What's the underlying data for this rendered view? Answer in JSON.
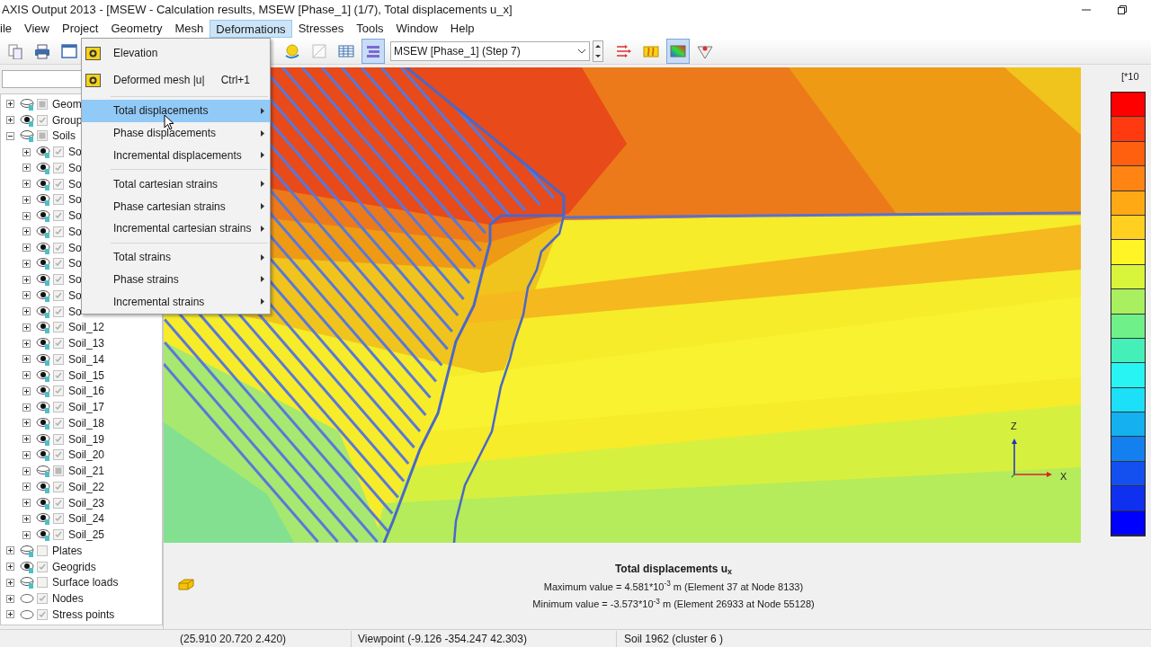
{
  "window": {
    "title": "AXIS Output 2013 - [MSEW - Calculation results, MSEW [Phase_1] (1/7), Total displacements u_x]"
  },
  "menu_bar": [
    {
      "label": "ile",
      "selected": false
    },
    {
      "label": "View",
      "selected": false
    },
    {
      "label": "Project",
      "selected": false
    },
    {
      "label": "Geometry",
      "selected": false
    },
    {
      "label": "Mesh",
      "selected": false
    },
    {
      "label": "Deformations",
      "selected": true
    },
    {
      "label": "Stresses",
      "selected": false
    },
    {
      "label": "Tools",
      "selected": false
    },
    {
      "label": "Window",
      "selected": false
    },
    {
      "label": "Help",
      "selected": false
    }
  ],
  "toolbar": {
    "left_buttons": [
      {
        "kind": "copy",
        "selected": false
      },
      {
        "kind": "print",
        "selected": false
      },
      {
        "kind": "window",
        "selected": false
      }
    ],
    "middle_buttons": [
      {
        "kind": "bulb",
        "selected": false
      },
      {
        "kind": "disabled",
        "selected": false
      },
      {
        "kind": "table",
        "selected": false
      },
      {
        "kind": "list",
        "selected": true
      }
    ],
    "step_selector": {
      "value": "MSEW [Phase_1] (Step 7)"
    },
    "right_buttons": [
      {
        "kind": "arrows",
        "selected": false
      },
      {
        "kind": "wave",
        "selected": false
      },
      {
        "kind": "gradient",
        "selected": true
      },
      {
        "kind": "funnel",
        "selected": false
      }
    ]
  },
  "deformations_menu": [
    {
      "label": "Elevation",
      "icon": true,
      "submenu": false,
      "selected": false,
      "separator_before": false
    },
    {
      "label": "Deformed mesh |u|",
      "shortcut": "Ctrl+1",
      "icon": true,
      "submenu": false,
      "selected": false,
      "separator_before": false
    },
    {
      "label": "Total displacements",
      "icon": false,
      "submenu": true,
      "selected": true,
      "separator_before": true
    },
    {
      "label": "Phase displacements",
      "icon": false,
      "submenu": true,
      "selected": false,
      "separator_before": false
    },
    {
      "label": "Incremental displacements",
      "icon": false,
      "submenu": true,
      "selected": false,
      "separator_before": false
    },
    {
      "label": "Total cartesian strains",
      "icon": false,
      "submenu": true,
      "selected": false,
      "separator_before": true
    },
    {
      "label": "Phase cartesian strains",
      "icon": false,
      "submenu": true,
      "selected": false,
      "separator_before": false
    },
    {
      "label": "Incremental cartesian strains",
      "icon": false,
      "submenu": true,
      "selected": false,
      "separator_before": false
    },
    {
      "label": "Total strains",
      "icon": false,
      "submenu": true,
      "selected": false,
      "separator_before": true
    },
    {
      "label": "Phase strains",
      "icon": false,
      "submenu": true,
      "selected": false,
      "separator_before": false
    },
    {
      "label": "Incremental strains",
      "icon": false,
      "submenu": true,
      "selected": false,
      "separator_before": false
    }
  ],
  "model_tree": [
    {
      "label": "Geom",
      "kind": "eye",
      "visible": false,
      "checked": false,
      "greyed": true,
      "expanded": false
    },
    {
      "label": "Group",
      "kind": "eye",
      "visible": true,
      "checked": true,
      "greyed": false,
      "expanded": false
    },
    {
      "label": "Soils",
      "kind": "eye",
      "visible": false,
      "checked": false,
      "greyed": true,
      "expanded": true,
      "children": [
        {
          "label": "So",
          "kind": "eye",
          "visible": true,
          "checked": true,
          "greyed": false,
          "expanded": false
        },
        {
          "label": "So",
          "kind": "eye",
          "visible": true,
          "checked": true,
          "greyed": false,
          "expanded": false
        },
        {
          "label": "So",
          "kind": "eye",
          "visible": true,
          "checked": true,
          "greyed": false,
          "expanded": false
        },
        {
          "label": "So",
          "kind": "eye",
          "visible": true,
          "checked": true,
          "greyed": false,
          "expanded": false
        },
        {
          "label": "So",
          "kind": "eye",
          "visible": true,
          "checked": true,
          "greyed": false,
          "expanded": false
        },
        {
          "label": "So",
          "kind": "eye",
          "visible": true,
          "checked": true,
          "greyed": false,
          "expanded": false
        },
        {
          "label": "So",
          "kind": "eye",
          "visible": true,
          "checked": true,
          "greyed": false,
          "expanded": false
        },
        {
          "label": "So",
          "kind": "eye",
          "visible": true,
          "checked": true,
          "greyed": false,
          "expanded": false
        },
        {
          "label": "So",
          "kind": "eye",
          "visible": true,
          "checked": true,
          "greyed": false,
          "expanded": false
        },
        {
          "label": "So",
          "kind": "eye",
          "visible": true,
          "checked": true,
          "greyed": false,
          "expanded": false
        },
        {
          "label": "So",
          "kind": "eye",
          "visible": true,
          "checked": true,
          "greyed": false,
          "expanded": false
        },
        {
          "label": "Soil_12",
          "kind": "eye",
          "visible": true,
          "checked": true,
          "greyed": false,
          "expanded": false
        },
        {
          "label": "Soil_13",
          "kind": "eye",
          "visible": true,
          "checked": true,
          "greyed": false,
          "expanded": false
        },
        {
          "label": "Soil_14",
          "kind": "eye",
          "visible": true,
          "checked": true,
          "greyed": false,
          "expanded": false
        },
        {
          "label": "Soil_15",
          "kind": "eye",
          "visible": true,
          "checked": true,
          "greyed": false,
          "expanded": false
        },
        {
          "label": "Soil_16",
          "kind": "eye",
          "visible": true,
          "checked": true,
          "greyed": false,
          "expanded": false
        },
        {
          "label": "Soil_17",
          "kind": "eye",
          "visible": true,
          "checked": true,
          "greyed": false,
          "expanded": false
        },
        {
          "label": "Soil_18",
          "kind": "eye",
          "visible": true,
          "checked": true,
          "greyed": false,
          "expanded": false
        },
        {
          "label": "Soil_19",
          "kind": "eye",
          "visible": true,
          "checked": true,
          "greyed": false,
          "expanded": false
        },
        {
          "label": "Soil_20",
          "kind": "eye",
          "visible": true,
          "checked": true,
          "greyed": false,
          "expanded": false
        },
        {
          "label": "Soil_21",
          "kind": "eye",
          "visible": false,
          "checked": false,
          "greyed": true,
          "expanded": false
        },
        {
          "label": "Soil_22",
          "kind": "eye",
          "visible": true,
          "checked": true,
          "greyed": false,
          "expanded": false
        },
        {
          "label": "Soil_23",
          "kind": "eye",
          "visible": true,
          "checked": true,
          "greyed": false,
          "expanded": false
        },
        {
          "label": "Soil_24",
          "kind": "eye",
          "visible": true,
          "checked": true,
          "greyed": false,
          "expanded": false
        },
        {
          "label": "Soil_25",
          "kind": "eye",
          "visible": true,
          "checked": true,
          "greyed": false,
          "expanded": false
        }
      ]
    },
    {
      "label": "Plates",
      "kind": "eye",
      "visible": false,
      "checked": false,
      "greyed": false,
      "expanded": false
    },
    {
      "label": "Geogrids",
      "kind": "eye",
      "visible": true,
      "checked": true,
      "greyed": false,
      "expanded": false
    },
    {
      "label": "Surface loads",
      "kind": "eye",
      "visible": false,
      "checked": false,
      "greyed": false,
      "expanded": false
    },
    {
      "label": "Nodes",
      "kind": "oval",
      "checked": true,
      "greyed": false,
      "expanded": false
    },
    {
      "label": "Stress points",
      "kind": "oval",
      "checked": true,
      "greyed": false,
      "expanded": false
    }
  ],
  "plot": {
    "axis_labels": [
      "Z",
      "X"
    ]
  },
  "legend": {
    "unit": "[*10",
    "swatches": [
      {
        "color": "#ff0000"
      },
      {
        "color": "#ff3a10"
      },
      {
        "color": "#ff6010"
      },
      {
        "color": "#ff8414"
      },
      {
        "color": "#ffaa14"
      },
      {
        "color": "#ffd020"
      },
      {
        "color": "#fff526"
      },
      {
        "color": "#d8f53c"
      },
      {
        "color": "#a8f060"
      },
      {
        "color": "#70f088"
      },
      {
        "color": "#44f0b8"
      },
      {
        "color": "#28f4f4"
      },
      {
        "color": "#1ce0f8"
      },
      {
        "color": "#14b0f0"
      },
      {
        "color": "#1480f0"
      },
      {
        "color": "#1450f0"
      },
      {
        "color": "#1030f0"
      },
      {
        "color": "#0000ff"
      }
    ]
  },
  "results": {
    "title": "Total displacements u$_{x}$",
    "lines": [
      "Maximum value = 4.581*10$^{-3}$ m (Element 37 at Node 8133)",
      "Minimum value = -3.573*10$^{-3}$ m (Element 26933 at Node 55128)"
    ]
  },
  "status_bar": [
    "(25.910 20.720 2.420)",
    "Viewpoint (-9.126 -354.247 42.303)",
    "Soil 1962 (cluster 6 )"
  ]
}
